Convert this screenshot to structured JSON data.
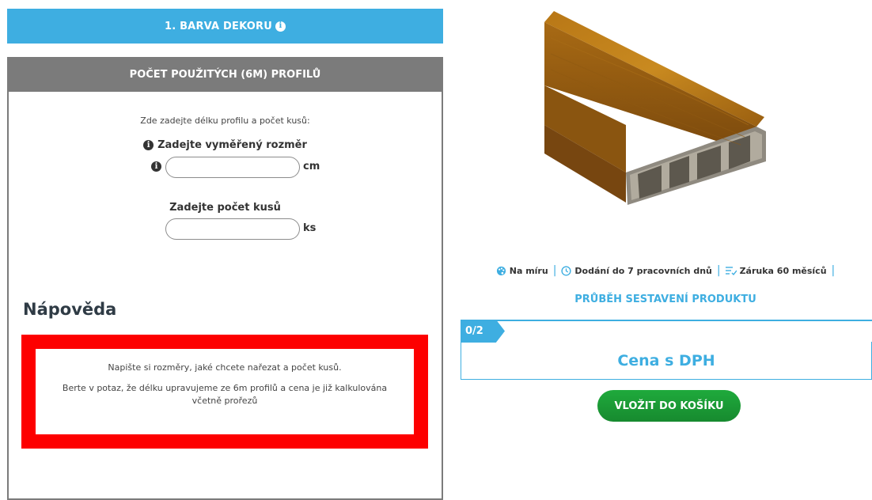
{
  "left": {
    "section_title": "1. BARVA DEKORU",
    "panel_title": "POČET POUŽITÝCH (6M) PROFILŮ",
    "instruction": "Zde zadejte délku profilu a počet kusů:",
    "measure_label": "Zadejte vyměřený rozměr",
    "measure_unit": "cm",
    "measure_value": "",
    "pieces_label": "Zadejte počet kusů",
    "pieces_unit": "ks",
    "pieces_value": "",
    "help_title": "Nápověda",
    "help_line1": "Napište si rozměry, jaké chcete nařezat a počet kusů.",
    "help_line2": "Berte v potaz, že délku upravujeme ze 6m profilů a cena je již kalkulována včetně prořezů"
  },
  "right": {
    "features": [
      {
        "icon": "palette-icon",
        "label": "Na míru"
      },
      {
        "icon": "clock-icon",
        "label": "Dodání do 7 pracovních dnů"
      },
      {
        "icon": "list-check-icon",
        "label": "Záruka 60 měsíců"
      }
    ],
    "progress_title": "PRŮBĚH SESTAVENÍ PRODUKTU",
    "progress_value": "0/2",
    "price_label": "Cena s DPH",
    "cart_button": "VLOŽIT DO KOŠÍKU"
  },
  "colors": {
    "accent_blue": "#3eaee1",
    "panel_gray": "#7b7b7b",
    "help_border_red": "#fd0000",
    "cart_green": "#1faa3c"
  }
}
